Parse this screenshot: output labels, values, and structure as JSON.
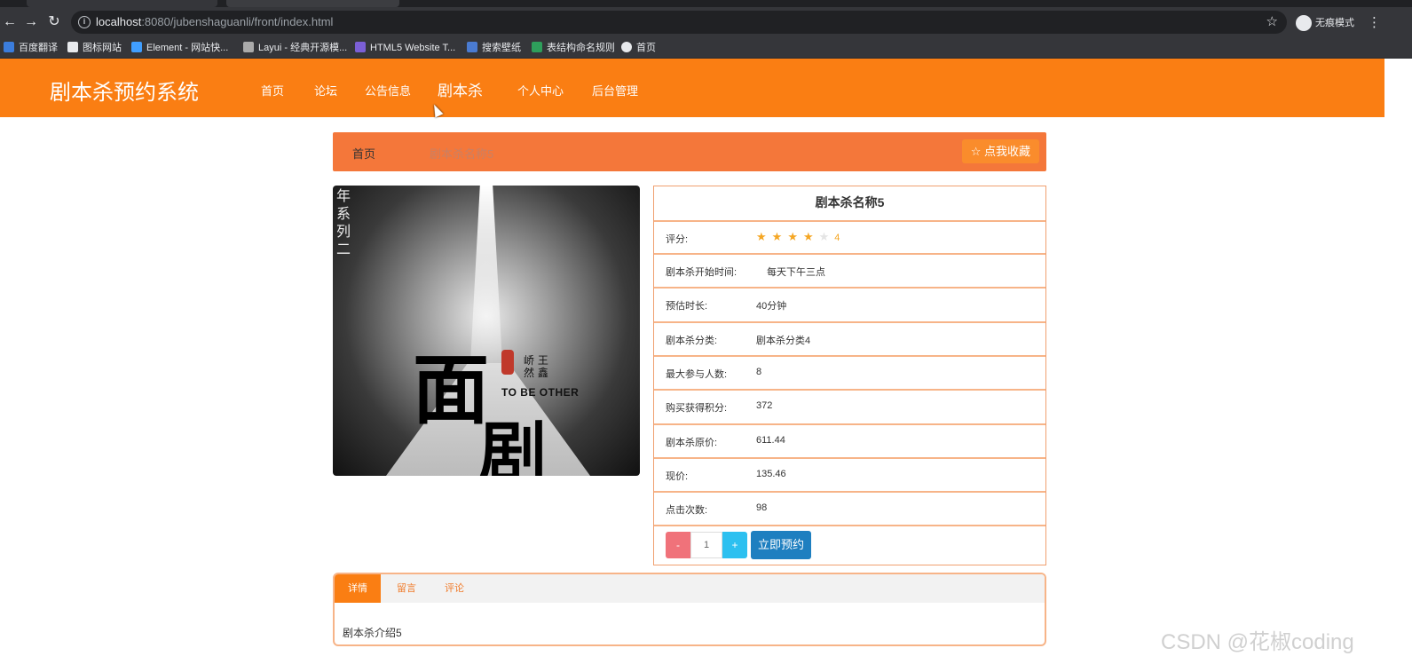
{
  "browser": {
    "url_host": "localhost",
    "url_path": ":8080/jubenshaguanli/front/index.html",
    "incognito_label": "无痕模式",
    "bookmarks": [
      {
        "label": "百度翻译",
        "icon": "translate-icon",
        "color": "#3b7ddd"
      },
      {
        "label": "图标网站",
        "icon": "flag-icon",
        "color": "#e8eaed"
      },
      {
        "label": "Element - 网站快...",
        "icon": "element-icon",
        "color": "#409eff"
      },
      {
        "label": "Layui - 经典开源模...",
        "icon": "layui-icon",
        "color": "#aaaaaa"
      },
      {
        "label": "HTML5 Website T...",
        "icon": "html5-icon",
        "color": "#7b5fd6"
      },
      {
        "label": "搜索壁纸",
        "icon": "wallpaper-icon",
        "color": "#4a7bd1"
      },
      {
        "label": "表结构命名规则",
        "icon": "doc-icon",
        "color": "#2e9e5b"
      },
      {
        "label": "首页",
        "icon": "globe-icon",
        "color": "#e8eaed"
      }
    ]
  },
  "site": {
    "title": "剧本杀预约系统",
    "nav": [
      "首页",
      "论坛",
      "公告信息",
      "剧本杀",
      "个人中心",
      "后台管理"
    ],
    "active_nav": "剧本杀",
    "brand_color": "#fa7e13"
  },
  "breadcrumb": {
    "home": "首页",
    "current": "剧本杀名称5",
    "favorite_label": "☆ 点我收藏"
  },
  "cover": {
    "vertical_text": "年系列二",
    "big_char_1": "面",
    "big_char_2": "剧",
    "names": "峤 王 然 鑫",
    "caption": "TO BE OTHER"
  },
  "detail": {
    "name": "剧本杀名称5",
    "rating_label": "评分:",
    "rating": 4,
    "rating_max": 5,
    "rating_text": "4",
    "rows": [
      {
        "label": "剧本杀开始时间:",
        "value": "每天下午三点"
      },
      {
        "label": "预估时长:",
        "value": "40分钟"
      },
      {
        "label": "剧本杀分类:",
        "value": "剧本杀分类4"
      },
      {
        "label": "最大参与人数:",
        "value": "8"
      },
      {
        "label": "购买获得积分:",
        "value": "372"
      },
      {
        "label": "剧本杀原价:",
        "value": "611.44"
      },
      {
        "label": "现价:",
        "value": "135.46"
      },
      {
        "label": "点击次数:",
        "value": "98"
      }
    ],
    "quantity": "1",
    "minus_label": "-",
    "plus_label": "+",
    "book_label": "立即预约"
  },
  "tabs": {
    "items": [
      "详情",
      "留言",
      "评论"
    ],
    "active": "详情",
    "content": "剧本杀介绍5"
  },
  "watermark": "CSDN @花椒coding"
}
